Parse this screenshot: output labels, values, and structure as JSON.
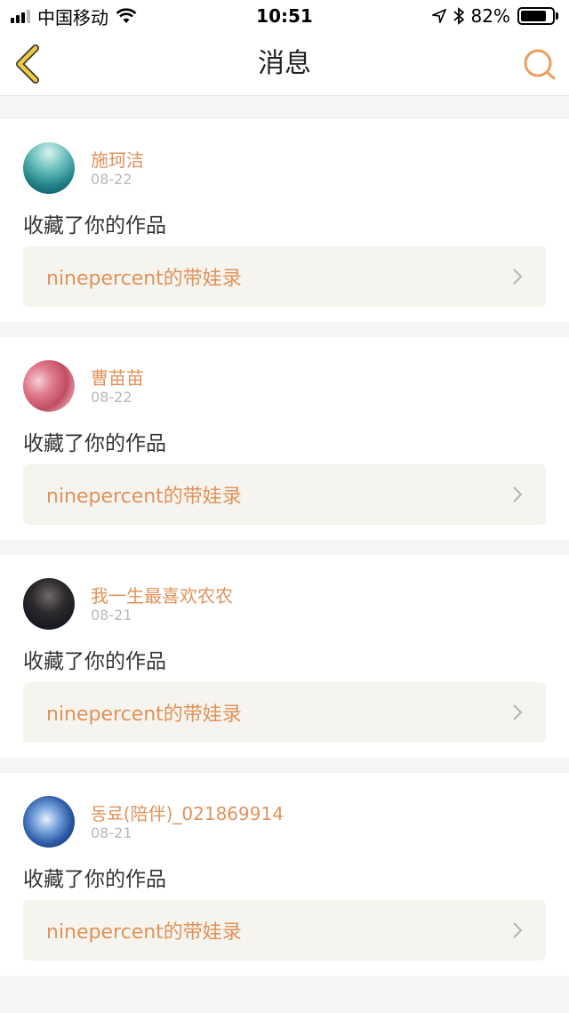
{
  "status_bar": {
    "carrier": "中国移动",
    "time": "10:51",
    "battery_percent": "82%",
    "battery_level": 0.82
  },
  "nav": {
    "title": "消息",
    "back_icon": "chevron-left-icon",
    "search_icon": "search-icon"
  },
  "colors": {
    "accent": "#e0935b",
    "back_icon": "#f1cc3d",
    "link_bg": "#f5f4ee"
  },
  "messages": [
    {
      "user": "施珂洁",
      "date": "08-22",
      "text": "收藏了你的作品",
      "work": "ninepercent的带娃录"
    },
    {
      "user": "曹苗苗",
      "date": "08-22",
      "text": "收藏了你的作品",
      "work": "ninepercent的带娃录"
    },
    {
      "user": "我一生最喜欢农农",
      "date": "08-21",
      "text": "收藏了你的作品",
      "work": "ninepercent的带娃录"
    },
    {
      "user": "동료(陪伴)_021869914",
      "date": "08-21",
      "text": "收藏了你的作品",
      "work": "ninepercent的带娃录"
    }
  ]
}
